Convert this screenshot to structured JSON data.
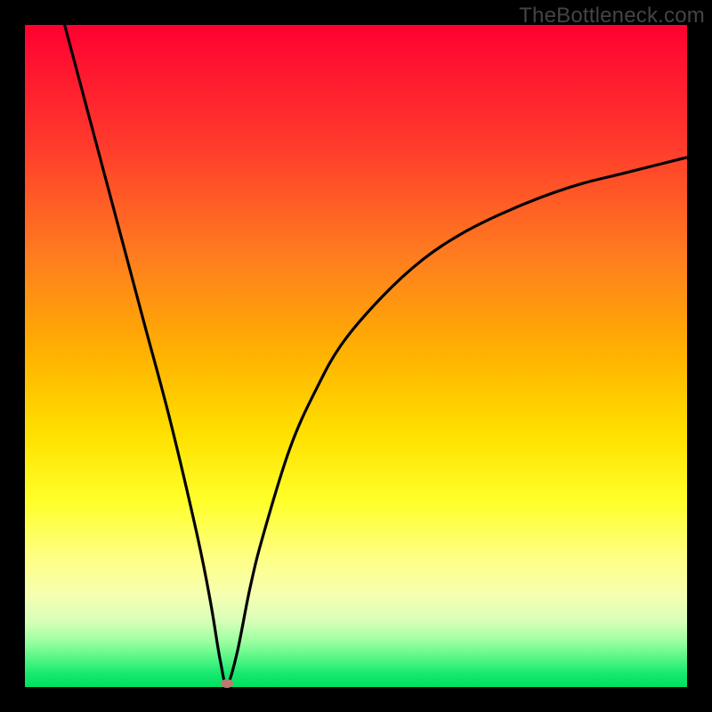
{
  "watermark": "TheBottleneck.com",
  "colors": {
    "frame": "#000000",
    "curve": "#000000",
    "marker": "#bd7a6f",
    "gradient_top": "#ff0030",
    "gradient_bottom": "#00e060"
  },
  "chart_data": {
    "type": "line",
    "title": "",
    "xlabel": "",
    "ylabel": "",
    "xlim": [
      0,
      100
    ],
    "ylim": [
      0,
      100
    ],
    "series": [
      {
        "name": "bottleneck-curve",
        "x": [
          6,
          10,
          14,
          18,
          22,
          26,
          28,
          29.5,
          30.5,
          32,
          34,
          36,
          40,
          44,
          48,
          54,
          60,
          66,
          72,
          78,
          84,
          90,
          96,
          100
        ],
        "y": [
          100,
          85,
          70,
          55,
          40,
          23,
          13,
          4,
          0.5,
          5,
          15,
          23,
          36,
          45,
          52,
          59,
          64.5,
          68.5,
          71.5,
          74,
          76,
          77.5,
          79,
          80
        ]
      }
    ],
    "marker": {
      "x": 30.5,
      "y": 0.5
    },
    "annotations": []
  }
}
